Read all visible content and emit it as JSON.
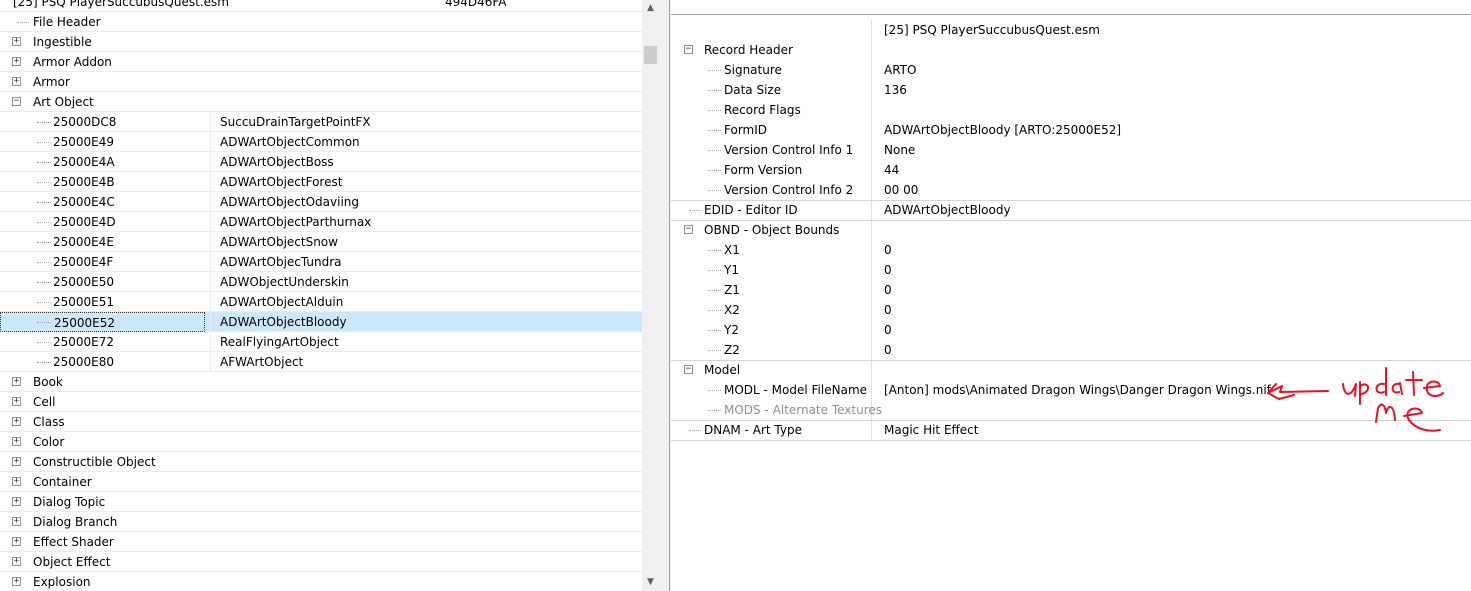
{
  "left_tree": {
    "plugin_name": "[25] PSQ PlayerSuccubusQuest.esm",
    "plugin_formid": "494D46FA",
    "groups_before": [
      {
        "label": "File Header",
        "expandable": false
      },
      {
        "label": "Ingestible",
        "expandable": true
      },
      {
        "label": "Armor Addon",
        "expandable": true
      },
      {
        "label": "Armor",
        "expandable": true
      },
      {
        "label": "Art Object",
        "expandable": true,
        "expanded": true
      }
    ],
    "art_objects": [
      {
        "id": "25000DC8",
        "name": "SuccuDrainTargetPointFX"
      },
      {
        "id": "25000E49",
        "name": "ADWArtObjectCommon"
      },
      {
        "id": "25000E4A",
        "name": "ADWArtObjectBoss"
      },
      {
        "id": "25000E4B",
        "name": "ADWArtObjectForest"
      },
      {
        "id": "25000E4C",
        "name": "ADWArtObjectOdaviing"
      },
      {
        "id": "25000E4D",
        "name": "ADWArtObjectParthurnax"
      },
      {
        "id": "25000E4E",
        "name": "ADWArtObjectSnow"
      },
      {
        "id": "25000E4F",
        "name": "ADWArtObjecTundra"
      },
      {
        "id": "25000E50",
        "name": "ADWObjectUnderskin"
      },
      {
        "id": "25000E51",
        "name": "ADWArtObjectAlduin"
      },
      {
        "id": "25000E52",
        "name": "ADWArtObjectBloody",
        "selected": true
      },
      {
        "id": "25000E72",
        "name": "RealFlyingArtObject"
      },
      {
        "id": "25000E80",
        "name": "AFWArtObject"
      }
    ],
    "groups_after": [
      {
        "label": "Book"
      },
      {
        "label": "Cell"
      },
      {
        "label": "Class"
      },
      {
        "label": "Color"
      },
      {
        "label": "Constructible Object"
      },
      {
        "label": "Container"
      },
      {
        "label": "Dialog Topic"
      },
      {
        "label": "Dialog Branch"
      },
      {
        "label": "Effect Shader"
      },
      {
        "label": "Object Effect"
      },
      {
        "label": "Explosion"
      }
    ]
  },
  "record_view": {
    "column_header": "[25] PSQ PlayerSuccubusQuest.esm",
    "rows": [
      {
        "label": "Record Header",
        "value": "",
        "level": 0,
        "expander": "-"
      },
      {
        "label": "Signature",
        "value": "ARTO",
        "level": 1
      },
      {
        "label": "Data Size",
        "value": "136",
        "level": 1
      },
      {
        "label": "Record Flags",
        "value": "",
        "level": 1
      },
      {
        "label": "FormID",
        "value": "ADWArtObjectBloody [ARTO:25000E52]",
        "level": 1
      },
      {
        "label": "Version Control Info 1",
        "value": "None",
        "level": 1
      },
      {
        "label": "Form Version",
        "value": "44",
        "level": 1
      },
      {
        "label": "Version Control Info 2",
        "value": "00 00",
        "level": 1
      },
      {
        "label": "EDID - Editor ID",
        "value": "ADWArtObjectBloody",
        "level": 0
      },
      {
        "label": "OBND - Object Bounds",
        "value": "",
        "level": 0,
        "expander": "-"
      },
      {
        "label": "X1",
        "value": "0",
        "level": 1
      },
      {
        "label": "Y1",
        "value": "0",
        "level": 1
      },
      {
        "label": "Z1",
        "value": "0",
        "level": 1
      },
      {
        "label": "X2",
        "value": "0",
        "level": 1
      },
      {
        "label": "Y2",
        "value": "0",
        "level": 1
      },
      {
        "label": "Z2",
        "value": "0",
        "level": 1
      },
      {
        "label": "Model",
        "value": "",
        "level": 0,
        "expander": "-"
      },
      {
        "label": "MODL - Model FileName",
        "value": "[Anton] mods\\Animated Dragon Wings\\Danger Dragon Wings.nif",
        "level": 1
      },
      {
        "label": "MODS - Alternate Textures",
        "value": "",
        "level": 1,
        "disabled": true
      },
      {
        "label": "DNAM - Art Type",
        "value": "Magic Hit Effect",
        "level": 0
      }
    ]
  },
  "annotation": {
    "text": "update me",
    "color": "#e81123"
  },
  "colors": {
    "selection": "#cce8ff",
    "annotation": "#e81123"
  }
}
